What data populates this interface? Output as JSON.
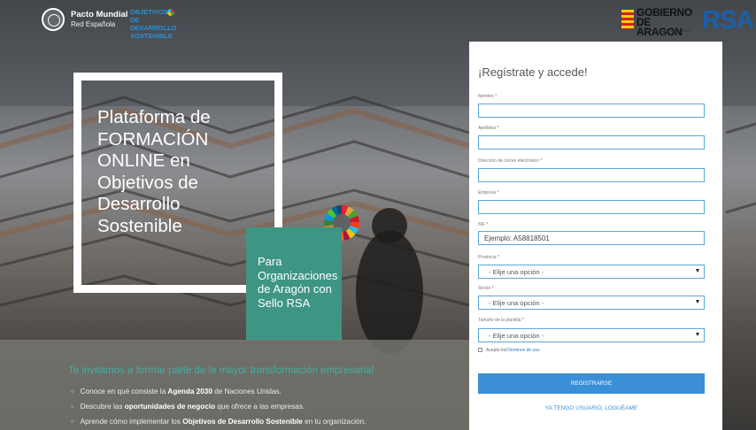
{
  "header": {
    "pacto_title": "Pacto Mundial",
    "pacto_sub": "Red Española",
    "ods_line1": "OBJETIVOS",
    "ods_line2": "DE DESARROLLO",
    "ods_line3": "SOSTENIBLE",
    "aragon_line1": "GOBIERNO",
    "aragon_line2": "DE ARAGON",
    "aragon_small": "Instituto Aragonés de Fomento",
    "rsa_logo": "RSA"
  },
  "hero": {
    "title": "Plataforma de FORMACIÓN ONLINE en Objetivos de Desarrollo Sostenible",
    "rsa_box_lines": [
      "Para",
      "Organizaciones",
      "de Aragón con",
      "Sello RSA"
    ]
  },
  "band": {
    "title": "Te invitamos a formar parte de la mayor transformación empresarial",
    "items": [
      {
        "pre": "Conoce en qué consiste la ",
        "bold": "Agenda 2030",
        "post": " de Naciones Unidas."
      },
      {
        "pre": "Descubre las ",
        "bold": "oportunidades de negocio",
        "post": " que ofrece a las empresas."
      },
      {
        "pre": "Aprende cómo implementar los ",
        "bold": "Objetivos de Desarrollo Sostenible",
        "post": " en tu organización."
      }
    ]
  },
  "form": {
    "title": "¡Regístrate y accede!",
    "nombre_label": "Nombre",
    "apellidos_label": "Apellidos",
    "email_label": "Dirección de correo electrónico",
    "empresa_label": "Empresa",
    "nif_label": "NIF",
    "nif_placeholder": "Ejemplo: A58818501",
    "provincia_label": "Provincia",
    "sector_label": "Sector",
    "tamano_label": "Tamaño de la plantilla",
    "select_default": "- Elije una opción -",
    "required_mark": "*",
    "terms_pre": "Acepto los",
    "terms_link": "Términos de uso",
    "register_button": "REGISTRARSE",
    "login_link": "YA TENGO USUARIO, LOGUÉAME"
  }
}
